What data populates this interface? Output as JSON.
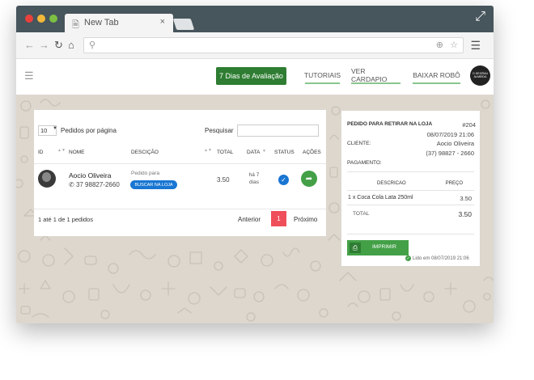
{
  "browser": {
    "tab_title": "New Tab"
  },
  "header": {
    "trial_button": "7 Dias de Avaliação",
    "nav": [
      "TUTORIAIS",
      "VER CARDAPIO",
      "BAIXAR ROBÔ"
    ]
  },
  "orders": {
    "per_page_value": "10",
    "per_page_label": "Pedidos por página",
    "search_label": "Pesquisar",
    "search_value": "",
    "columns": [
      "ID",
      "NOME",
      "DESCIÇÃO",
      "TOTAL",
      "DATA",
      "STATUS",
      "AÇÕES"
    ],
    "row": {
      "name": "Aocio Oliveira",
      "phone": "37 98827-2660",
      "description": "Pedido para",
      "badge": "BUSCAR NA LOJA",
      "total": "3.50",
      "date_line1": "há 7",
      "date_line2": "dias"
    },
    "info": "1 até 1 de 1 pedidos",
    "prev": "Anterior",
    "page": "1",
    "next": "Próximo"
  },
  "detail": {
    "title": "PEDIDO PARA RETIRAR NA LOJA",
    "number": "#204",
    "date": "08/07/2019 21:06",
    "client_label": "CLIENTE:",
    "client_name": "Aocio Oliveira",
    "client_phone": "(37) 98827 - 2660",
    "payment_label": "PAGAMENTO:",
    "col_desc": "DESCRICAO",
    "col_price": "PREÇO",
    "item": "1 x Coca Cola Lata 250ml",
    "item_price": "3.50",
    "total_label": "TOTAL",
    "total_value": "3.50",
    "print_button": "IMPRIMIR",
    "read_status": "Lido em 08/07/2019 21:06"
  },
  "colors": {
    "accent_green": "#2e7d32",
    "action_green": "#43a047",
    "badge_blue": "#1976d2",
    "page_red": "#ef4f5a",
    "tab_bar": "#47555c"
  },
  "icons": [
    "page-icon",
    "close-icon",
    "expand-icon",
    "back-arrow-icon",
    "forward-arrow-icon",
    "reload-icon",
    "home-icon",
    "search-icon",
    "zoom-icon",
    "star-icon",
    "menu-icon",
    "hamburger-icon",
    "whatsapp-icon",
    "check-icon",
    "forward-icon",
    "printer-icon",
    "check-circle-icon"
  ]
}
